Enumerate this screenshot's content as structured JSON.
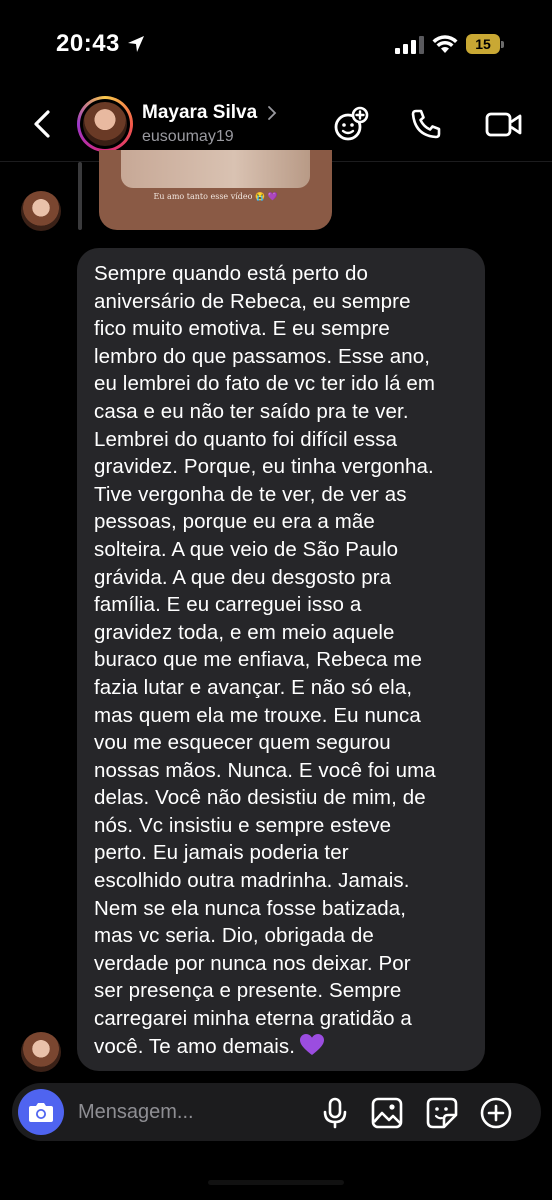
{
  "status_bar": {
    "time": "20:43",
    "battery": "15",
    "battery_color": "#c9a834"
  },
  "header": {
    "name": "Mayara Silva",
    "username": "eusoumay19",
    "icons": [
      "back-icon",
      "effects-icon",
      "phone-icon",
      "video-icon"
    ]
  },
  "story_reply": {
    "caption": "Eu amo tanto esse vídeo 😭 💜"
  },
  "message": {
    "text": "Sempre quando está perto do\naniversário de Rebeca, eu sempre\nfico muito emotiva. E eu sempre\nlembro do que passamos. Esse ano,\neu lembrei do fato de vc ter ido lá em\ncasa e eu não ter saído pra te ver.\nLembrei do quanto foi difícil essa\ngravidez. Porque, eu tinha vergonha.\nTive vergonha de te ver, de ver as\npessoas, porque eu era a mãe\nsolteira. A que veio de São Paulo\ngrávida. A que deu desgosto pra\nfamília. E eu carreguei isso a\ngravidez toda, e em meio aquele\nburaco que me enfiava, Rebeca me\nfazia lutar e avançar. E não só ela,\nmas quem ela me trouxe. Eu nunca\nvou me esquecer quem segurou\nnossas mãos. Nunca. E você foi uma\ndelas. Você não desistiu de mim, de\nnós. Vc insistiu e sempre esteve\nperto. Eu jamais poderia ter\nescolhido outra madrinha. Jamais.\nNem se ela nunca fosse batizada,\nmas vc seria. Dio, obrigada de\nverdade por nunca nos deixar. Por\nser presença e presente. Sempre\ncarregarei minha eterna gratidão a\nvocê. Te amo demais.",
    "emoji": "purple-heart-icon",
    "bubble_color": "#262629"
  },
  "composer": {
    "placeholder": "Mensagem...",
    "camera_color": "#4f64f0",
    "icons": [
      "camera-icon",
      "mic-icon",
      "gallery-icon",
      "sticker-icon",
      "plus-icon"
    ]
  }
}
